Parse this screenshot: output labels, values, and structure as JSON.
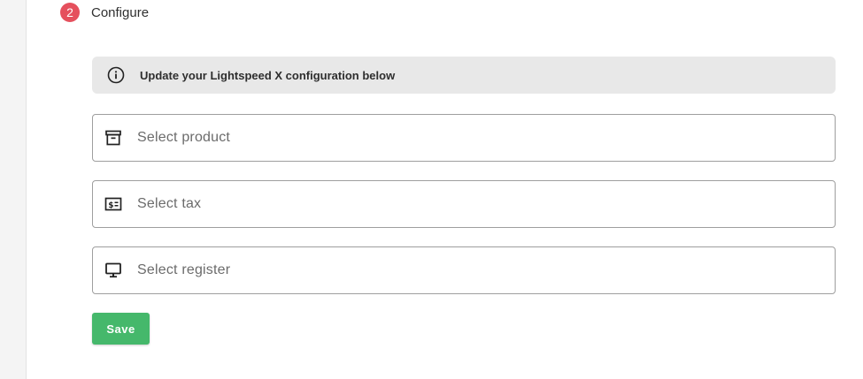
{
  "step": {
    "number": "2",
    "title": "Configure",
    "badge_color": "#e5505d"
  },
  "info_banner": {
    "icon": "info-icon",
    "text": "Update your Lightspeed X configuration below"
  },
  "fields": [
    {
      "icon": "archive-box-icon",
      "placeholder": "Select product"
    },
    {
      "icon": "tax-receipt-icon",
      "placeholder": "Select tax"
    },
    {
      "icon": "monitor-icon",
      "placeholder": "Select register"
    }
  ],
  "save_button": {
    "label": "Save",
    "color": "#45b86b"
  }
}
